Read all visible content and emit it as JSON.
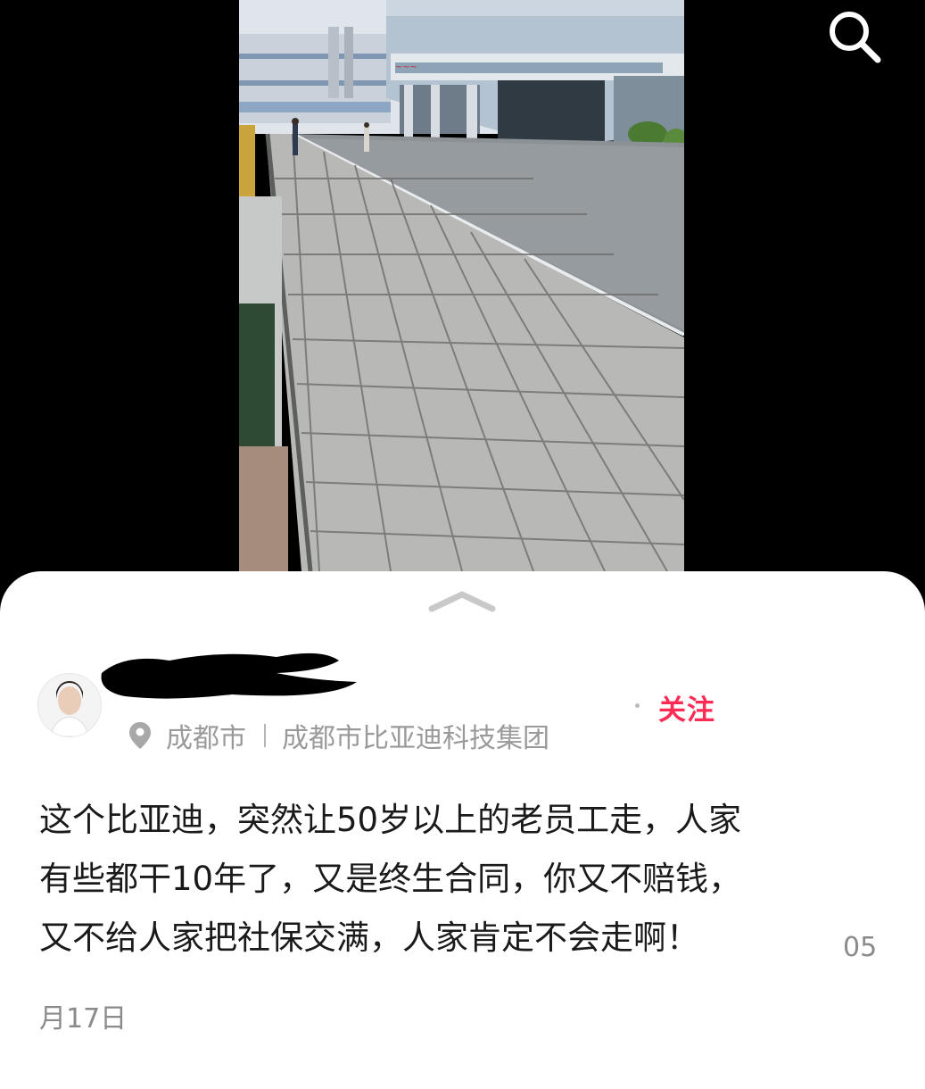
{
  "header": {
    "search_icon": "search-icon"
  },
  "media": {
    "description_icon": "street-photo"
  },
  "sheet": {
    "handle_icon": "chevron-up-icon",
    "author": {
      "name": "",
      "avatar_icon": "avatar"
    },
    "follow_label": "关注",
    "location": {
      "pin_icon": "location-pin-icon",
      "city": "成都市",
      "place": "成都市比亚迪科技集团"
    },
    "post": {
      "lines": [
        "这个比亚迪，突然让50岁以上的老员工走，人家",
        "有些都干10年了，又是终生合同，你又不赔钱，",
        "又不给人家把社保交满，人家肯定不会走啊！"
      ],
      "date_part1": "05",
      "date_part2": "月17日"
    }
  },
  "colors": {
    "accent": "#fe2c55",
    "meta_text": "#9a9a9a",
    "body_text": "#1a1a1a"
  }
}
